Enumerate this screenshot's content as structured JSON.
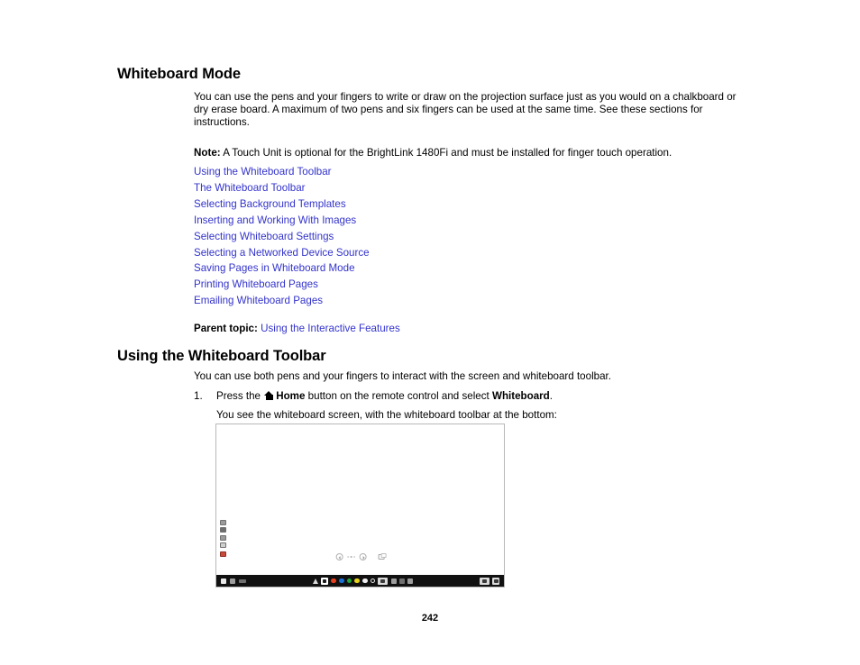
{
  "document": {
    "section_title": "Whiteboard Mode",
    "intro_paragraph": "You can use the pens and your fingers to write or draw on the projection surface just as you would on a chalkboard or dry erase board. A maximum of two pens and six fingers can be used at the same time. See these sections for instructions.",
    "note": {
      "label": "Note:",
      "text": " A Touch Unit is optional for the BrightLink 1480Fi and must be installed for finger touch operation."
    },
    "links": [
      "Using the Whiteboard Toolbar",
      "The Whiteboard Toolbar",
      "Selecting Background Templates",
      "Inserting and Working With Images",
      "Selecting Whiteboard Settings",
      "Selecting a Networked Device Source",
      "Saving Pages in Whiteboard Mode",
      "Printing Whiteboard Pages",
      "Emailing Whiteboard Pages"
    ],
    "parent_topic": {
      "label": "Parent topic:",
      "link": "Using the Interactive Features"
    },
    "subsection": {
      "title": "Using the Whiteboard Toolbar",
      "intro": "You can use both pens and your fingers to interact with the screen and whiteboard toolbar.",
      "step_number": "1.",
      "step_text_before": "Press the",
      "step_icon": "home-icon",
      "step_icon_label": "Home",
      "step_text_middle": "button on the remote control and select",
      "step_bold_word": "Whiteboard",
      "step_text_end": ".",
      "step_result": "You see the whiteboard screen, with the whiteboard toolbar at the bottom:"
    },
    "page_number": "242",
    "colors": {
      "link": "#3333cc",
      "text": "#000000",
      "figure_border": "#b8b8b8",
      "toolbar_background": "#111111"
    }
  },
  "figure": {
    "name": "whiteboard-screen-capture",
    "canvas_background": "#ffffff",
    "left_tools": [
      {
        "name": "wb-tool-capture",
        "shade": "grey"
      },
      {
        "name": "wb-tool-print",
        "shade": "dark"
      },
      {
        "name": "wb-tool-save",
        "shade": "grey"
      },
      {
        "name": "wb-tool-settings",
        "shade": "light"
      },
      {
        "name": "wb-tool-record",
        "shade": "red"
      }
    ],
    "page_nav": {
      "prev": "prev-page-arrow",
      "next": "next-page-arrow",
      "dot_count": 3,
      "add_page": "add-page-icon"
    },
    "toolbar": {
      "left_icons": [
        "wb-tb-new-page",
        "wb-tb-open-file",
        "wb-tb-menu"
      ],
      "pen_icon": "pen-tool-icon",
      "selected_tool": "pen-selected",
      "palette": [
        {
          "name": "color-red",
          "hex": "#e8401f"
        },
        {
          "name": "color-blue",
          "hex": "#1b6fd8"
        },
        {
          "name": "color-green",
          "hex": "#20a83c"
        },
        {
          "name": "color-yellow",
          "hex": "#e8d41c"
        },
        {
          "name": "color-black",
          "hex": "#f0f0f0"
        },
        {
          "name": "color-custom",
          "hex": "hollow"
        }
      ],
      "right_tools": [
        "eraser-icon",
        "undo-icon",
        "redo-icon",
        "trash-icon"
      ],
      "corner_buttons": [
        "wb-tb-screen-share",
        "wb-tb-close"
      ]
    }
  }
}
